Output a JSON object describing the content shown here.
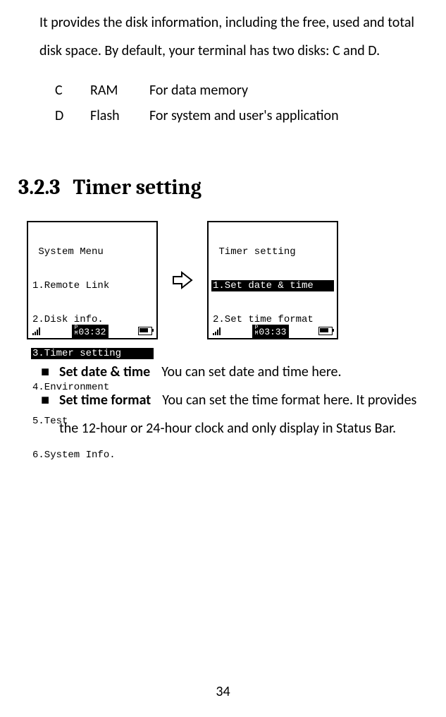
{
  "intro_text": "It provides the disk information, including the free, used and total disk space. By default, your terminal has two disks: C and D.",
  "disk_table": [
    {
      "drive": "C",
      "type": "RAM",
      "desc": "For data memory"
    },
    {
      "drive": "D",
      "type": "Flash",
      "desc": "For system and user's application"
    }
  ],
  "section": {
    "number": "3.2.3",
    "title": "Timer setting"
  },
  "screens": {
    "left": {
      "title": " System Menu",
      "items": [
        "1.Remote Link",
        "2.Disk info.",
        "3.Timer setting",
        "4.Environment",
        "5.Test",
        "6.System Info."
      ],
      "selected_index": 2,
      "ampm": "P\nM",
      "time": "03:32"
    },
    "right": {
      "title": " Timer setting",
      "items": [
        "1.Set date & time",
        "2.Set time format"
      ],
      "selected_index": 0,
      "ampm": "P\nM",
      "time": "03:33"
    }
  },
  "bullets": [
    {
      "title": "Set date & time",
      "text": "You can set date and time here."
    },
    {
      "title": "Set time format",
      "text": "You can set the time format here. It provides the 12-hour or 24-hour clock and only display in Status Bar."
    }
  ],
  "page_number": "34"
}
